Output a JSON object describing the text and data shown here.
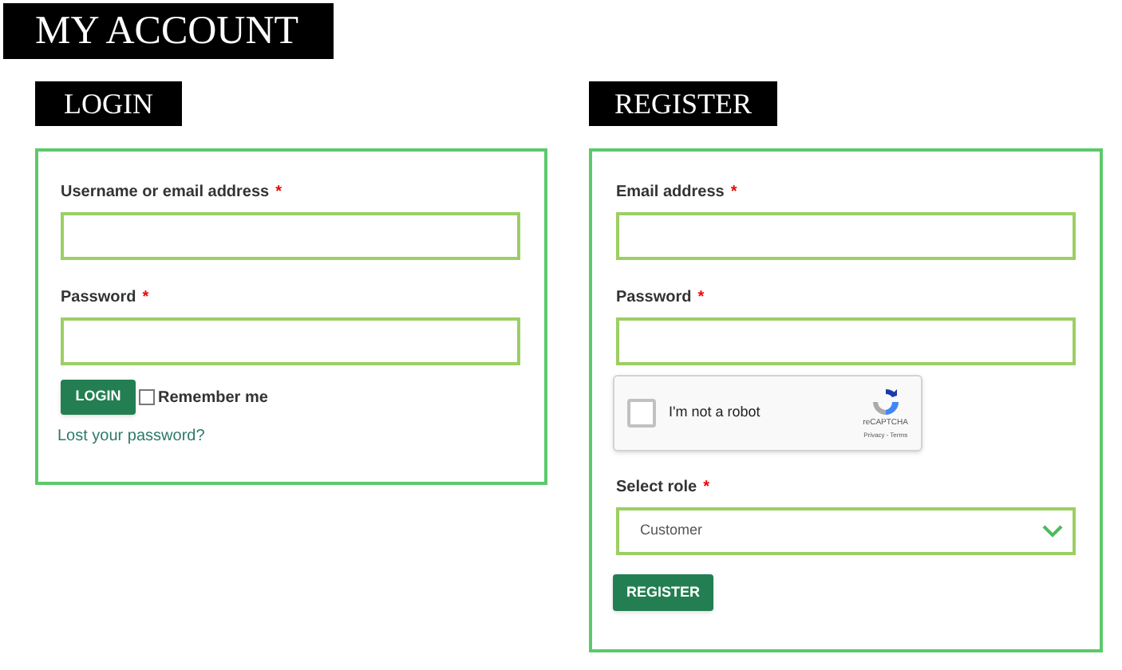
{
  "page_title": "MY ACCOUNT",
  "login": {
    "heading": "LOGIN",
    "fields": [
      {
        "label": "Username or email address",
        "required_mark": "*"
      },
      {
        "label": "Password",
        "required_mark": "*"
      }
    ],
    "button": "LOGIN",
    "remember": {
      "label": "Remember me",
      "checked": false
    },
    "lost_password_link": "Lost your password?"
  },
  "register": {
    "heading": "REGISTER",
    "fields": [
      {
        "label": "Email address",
        "required_mark": "*"
      },
      {
        "label": "Password",
        "required_mark": "*"
      }
    ],
    "captcha": {
      "label": "I'm not a robot",
      "checked": false,
      "brand": "reCAPTCHA",
      "links": "Privacy - Terms"
    },
    "role": {
      "label": "Select role",
      "required_mark": "*",
      "value": "Customer"
    },
    "button": "REGISTER"
  }
}
